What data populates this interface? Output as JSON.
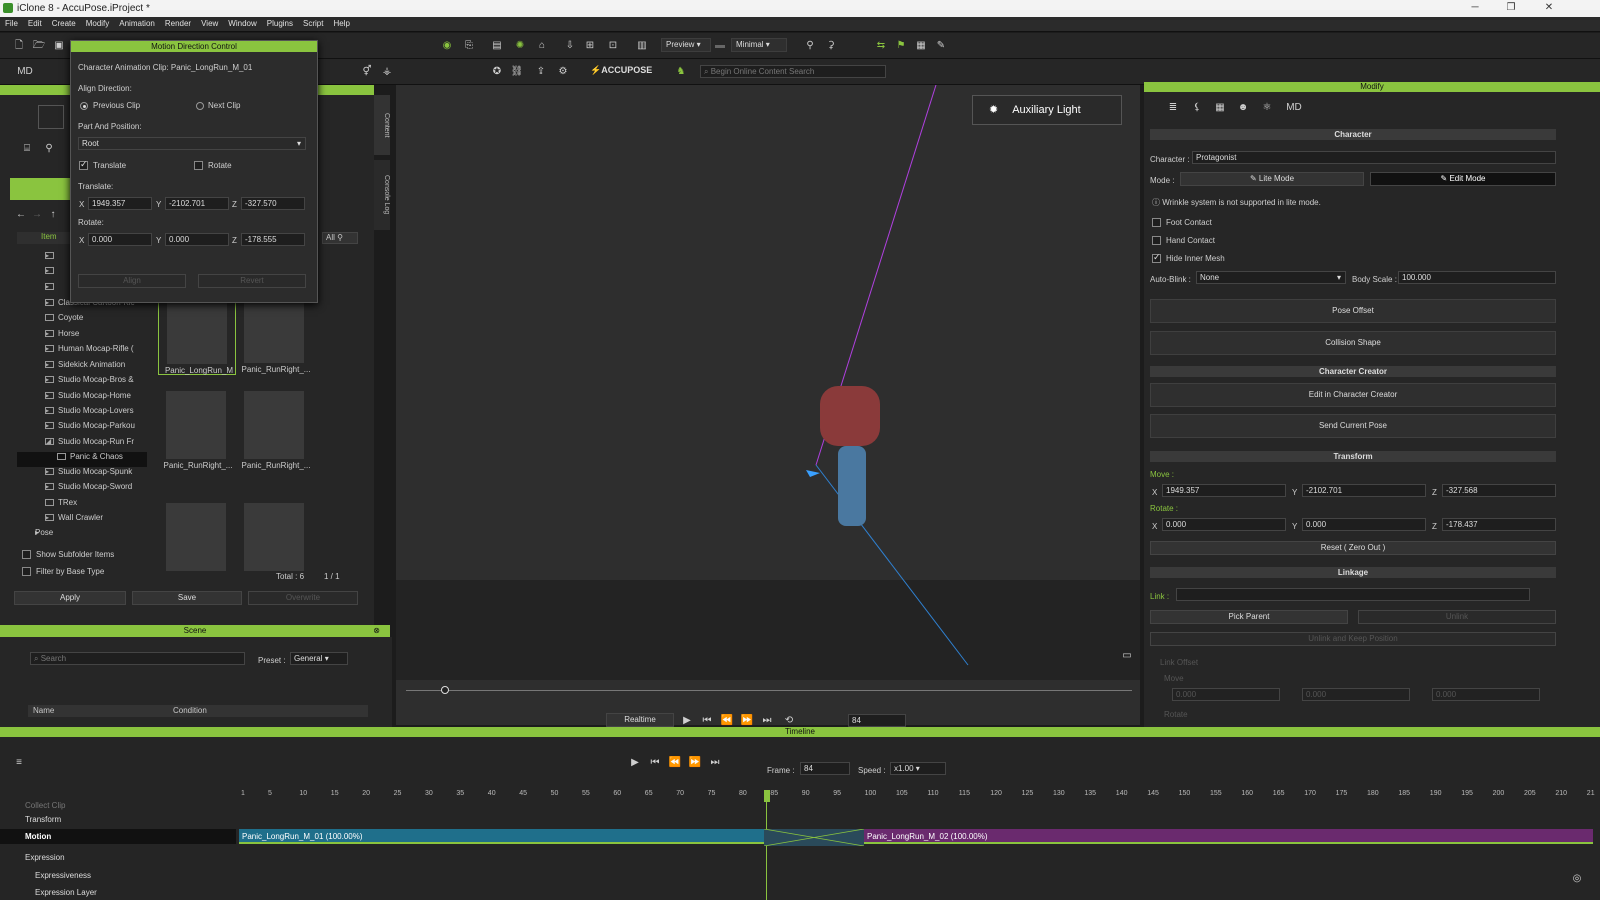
{
  "window": {
    "title": "iClone 8 - AccuPose.iProject *"
  },
  "menu": [
    "File",
    "Edit",
    "Create",
    "Modify",
    "Animation",
    "Render",
    "View",
    "Window",
    "Plugins",
    "Script",
    "Help"
  ],
  "toolbar": {
    "preview_label": "Preview",
    "quality_label": "Minimal",
    "accupose_label": "ACCUPOSE",
    "search_placeholder": "Begin Online Content Search"
  },
  "dialog": {
    "title": "Motion Direction Control",
    "clip_label": "Character Animation Clip: Panic_LongRun_M_01",
    "align_direction_label": "Align Direction:",
    "previous_clip": "Previous Clip",
    "next_clip": "Next Clip",
    "part_position_label": "Part And Position:",
    "part_value": "Root",
    "translate_check": "Translate",
    "rotate_check": "Rotate",
    "translate_label": "Translate:",
    "rotate_label": "Rotate:",
    "translate": {
      "x": "1949.357",
      "y": "-2102.701",
      "z": "-327.570"
    },
    "rotate": {
      "x": "0.000",
      "y": "0.000",
      "z": "-178.555"
    },
    "align_btn": "Align",
    "revert_btn": "Revert"
  },
  "library": {
    "header_label": "Item",
    "tree": [
      {
        "label": "",
        "arrow": "▸"
      },
      {
        "label": "",
        "arrow": "▸"
      },
      {
        "label": "",
        "arrow": "▸"
      },
      {
        "label": "Classical Cartoon-Kic",
        "arrow": "▸"
      },
      {
        "label": "Coyote",
        "arrow": ""
      },
      {
        "label": "Horse",
        "arrow": "▸"
      },
      {
        "label": "Human Mocap-Rifle (",
        "arrow": "▸"
      },
      {
        "label": "Sidekick Animation",
        "arrow": "▸"
      },
      {
        "label": "Studio Mocap-Bros &",
        "arrow": "▸"
      },
      {
        "label": "Studio Mocap-Home",
        "arrow": "▸"
      },
      {
        "label": "Studio Mocap-Lovers",
        "arrow": "▸"
      },
      {
        "label": "Studio Mocap-Parkou",
        "arrow": "▸"
      },
      {
        "label": "Studio Mocap-Run Fr",
        "arrow": "◢"
      },
      {
        "label": "Panic & Chaos",
        "arrow": ""
      },
      {
        "label": "Studio Mocap-Spunk",
        "arrow": "▸"
      },
      {
        "label": "Studio Mocap-Sword",
        "arrow": "▸"
      },
      {
        "label": "TRex",
        "arrow": ""
      },
      {
        "label": "Wall Crawler",
        "arrow": "▸"
      },
      {
        "label": "Pose",
        "arrow": "▸"
      }
    ],
    "thumbs": [
      "Panic_LongRun_M",
      "Panic_RunRight_...",
      "Panic_RunRight_...",
      "Panic_RunRight_...",
      "",
      ""
    ],
    "filter_all": "All",
    "show_subfolder": "Show Subfolder Items",
    "filter_base": "Filter by Base Type",
    "total": "Total : 6",
    "page": "1 / 1",
    "apply": "Apply",
    "save": "Save",
    "overwrite": "Overwrite",
    "tab_content": "Content",
    "tab_console": "Console Log"
  },
  "scene": {
    "title": "Scene",
    "search_placeholder": "Search",
    "preset_label": "Preset :",
    "preset_value": "General",
    "col_name": "Name",
    "col_condition": "Condition"
  },
  "viewport": {
    "aux_light": "Auxiliary Light",
    "realtime": "Realtime",
    "frame": "84"
  },
  "modify": {
    "title": "Modify",
    "character_sec": "Character",
    "character_label": "Character :",
    "character_value": "Protagonist",
    "mode_label": "Mode :",
    "lite_mode": "Lite Mode",
    "edit_mode": "Edit Mode",
    "wrinkle_note": "Wrinkle system is not supported in lite mode.",
    "foot_contact": "Foot Contact",
    "hand_contact": "Hand Contact",
    "hide_inner": "Hide Inner Mesh",
    "auto_blink_label": "Auto-Blink :",
    "auto_blink_value": "None",
    "body_scale_label": "Body Scale :",
    "body_scale_value": "100.000",
    "pose_offset": "Pose Offset",
    "collision_shape": "Collision Shape",
    "cc_sec": "Character Creator",
    "edit_cc": "Edit in Character Creator",
    "send_pose": "Send Current Pose",
    "transform_sec": "Transform",
    "move_label": "Move :",
    "move": {
      "x": "1949.357",
      "y": "-2102.701",
      "z": "-327.568"
    },
    "rotate_label": "Rotate :",
    "rotate": {
      "x": "0.000",
      "y": "0.000",
      "z": "-178.437"
    },
    "reset": "Reset ( Zero Out )",
    "linkage_sec": "Linkage",
    "link_label": "Link :",
    "pick_parent": "Pick Parent",
    "unlink": "Unlink",
    "unlink_keep": "Unlink and Keep Position",
    "link_offset": "Link Offset",
    "move_dim": "Move",
    "rotate_dim": "Rotate",
    "dim_values": {
      "x": "0.000",
      "y": "0.000",
      "z": "0.000"
    }
  },
  "timeline": {
    "title": "Timeline",
    "frame_label": "Frame :",
    "frame_value": "84",
    "speed_label": "Speed :",
    "speed_value": "x1.00",
    "ticks": [
      "1",
      "5",
      "10",
      "15",
      "20",
      "25",
      "30",
      "35",
      "40",
      "45",
      "50",
      "55",
      "60",
      "65",
      "70",
      "75",
      "80",
      "85",
      "90",
      "95",
      "100",
      "105",
      "110",
      "115",
      "120",
      "125",
      "130",
      "135",
      "140",
      "145",
      "150",
      "155",
      "160",
      "165",
      "170",
      "175",
      "180",
      "185",
      "190",
      "195",
      "200",
      "205",
      "210",
      "21"
    ],
    "tracks": [
      "Collect Clip",
      "Transform",
      "Motion",
      "Expression",
      "Expressiveness",
      "Expression Layer"
    ],
    "clip1": "Panic_LongRun_M_01 (100.00%)",
    "clip2": "Panic_LongRun_M_02 (100.00%)"
  }
}
